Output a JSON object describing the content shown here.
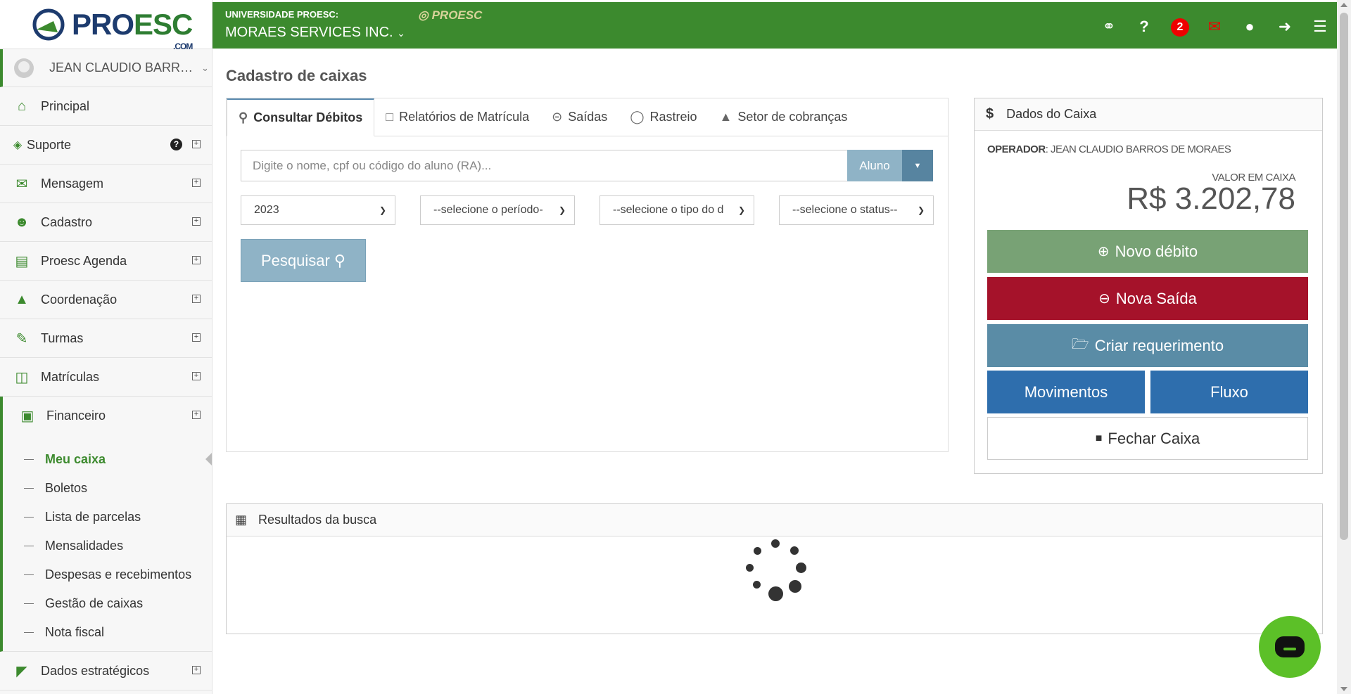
{
  "sidebar": {
    "logo": {
      "text_main": "PRO",
      "text_accent": "ESC",
      "suffix": ".COM"
    },
    "user_name": "JEAN CLAUDIO BARROS DE MORAES",
    "nav": [
      {
        "label": "Principal",
        "icon": "home-icon"
      },
      {
        "label": "Suporte",
        "icon": "ticket-icon"
      },
      {
        "label": "Mensagem",
        "icon": "envelope-icon"
      },
      {
        "label": "Cadastro",
        "icon": "users-icon"
      },
      {
        "label": "Proesc Agenda",
        "icon": "book-icon"
      },
      {
        "label": "Coordenação",
        "icon": "graduation-cap-icon"
      },
      {
        "label": "Turmas",
        "icon": "pencil-icon"
      },
      {
        "label": "Matrículas",
        "icon": "open-book-icon"
      },
      {
        "label": "Financeiro",
        "icon": "money-icon"
      },
      {
        "label": "Dados estratégicos",
        "icon": "area-chart-icon"
      }
    ],
    "financeiro_submenu": [
      "Meu caixa",
      "Boletos",
      "Lista de parcelas",
      "Mensalidades",
      "Despesas e recebimentos",
      "Gestão de caixas",
      "Nota fiscal"
    ],
    "current_submenu": "Meu caixa"
  },
  "header": {
    "university": "UNIVERSIDADE PROESC:",
    "organization": "MORAES SERVICES INC.",
    "brand": "PROESC",
    "notification_count": "2",
    "accent": "#3c8a2e"
  },
  "main": {
    "title": "Cadastro de caixas",
    "tabs": [
      {
        "label": "Consultar Débitos",
        "icon": "search-icon"
      },
      {
        "label": "Relatórios de Matrícula",
        "icon": "folder-icon"
      },
      {
        "label": "Saídas",
        "icon": "minus-circle-icon"
      },
      {
        "label": "Rastreio",
        "icon": "snapchat-icon"
      },
      {
        "label": "Setor de cobranças",
        "icon": "fire-icon"
      }
    ],
    "search": {
      "placeholder": "Digite o nome, cpf ou código do aluno (RA)...",
      "type_button": "Aluno"
    },
    "filters": {
      "year": "2023",
      "period": "--selecione o período-",
      "type": "--selecione o tipo do d",
      "status": "--selecione o status--"
    },
    "search_button": "Pesquisar"
  },
  "caixa": {
    "title": "Dados do Caixa",
    "operator_label": "OPERADOR",
    "operator_name": ": JEAN CLAUDIO BARROS DE MORAES",
    "value_label": "VALOR EM CAIXA",
    "value": "R$ 3.202,78",
    "buttons": {
      "novo_debito": "Novo débito",
      "nova_saida": "Nova Saída",
      "criar_requerimento": "Criar requerimento",
      "movimentos": "Movimentos",
      "fluxo": "Fluxo",
      "fechar_caixa": "Fechar Caixa"
    }
  },
  "results": {
    "title": "Resultados da busca"
  }
}
